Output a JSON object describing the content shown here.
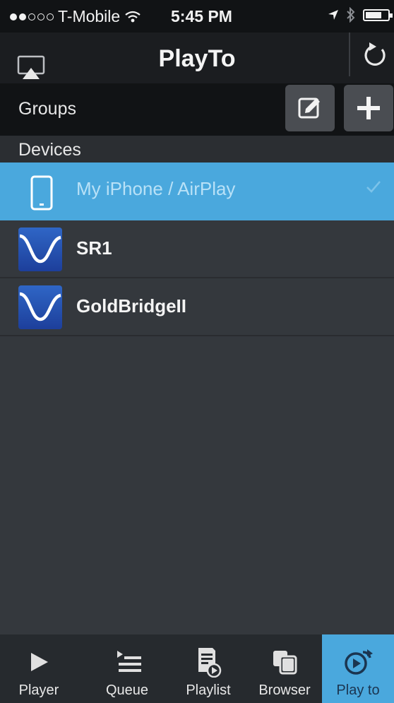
{
  "status_bar": {
    "carrier": "T-Mobile",
    "time": "5:45 PM"
  },
  "nav": {
    "title": "PlayTo"
  },
  "groups": {
    "label": "Groups"
  },
  "devices_section": {
    "label": "Devices"
  },
  "devices": [
    {
      "name": "My iPhone / AirPlay",
      "selected": true,
      "icon": "phone-icon"
    },
    {
      "name": "SR1",
      "selected": false,
      "icon": "wave-icon"
    },
    {
      "name": "GoldBridgeII",
      "selected": false,
      "icon": "wave-icon"
    }
  ],
  "tabs": [
    {
      "label": "Player",
      "icon": "play-icon"
    },
    {
      "label": "Queue",
      "icon": "queue-icon"
    },
    {
      "label": "Playlist",
      "icon": "playlist-icon"
    },
    {
      "label": "Browser",
      "icon": "browser-icon"
    },
    {
      "label": "Play to",
      "icon": "playto-icon",
      "active": true
    }
  ],
  "colors": {
    "accent": "#4aa8dd",
    "background": "#34383d",
    "bar_dark": "#111315"
  }
}
